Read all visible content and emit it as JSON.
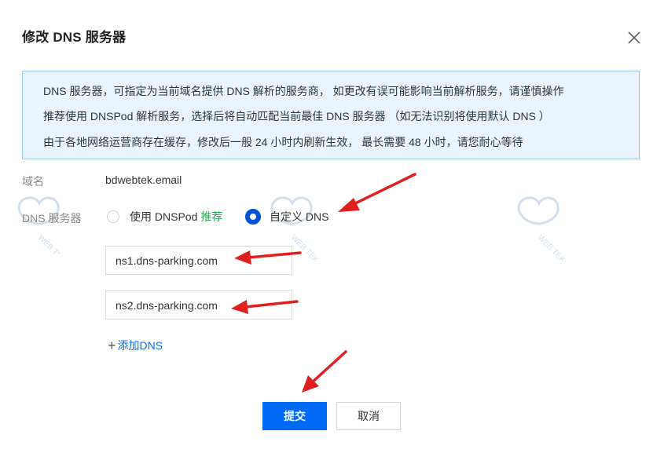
{
  "dialog": {
    "title": "修改 DNS 服务器"
  },
  "notice": {
    "lines": [
      "DNS 服务器，可指定为当前域名提供 DNS 解析的服务商， 如更改有误可能影响当前解析服务，请谨慎操作",
      "推荐使用 DNSPod 解析服务，选择后将自动匹配当前最佳 DNS 服务器 （如无法识别将使用默认 DNS ）",
      "由于各地网络运营商存在缓存，修改后一般 24 小时内刷新生效， 最长需要 48 小时，请您耐心等待"
    ]
  },
  "form": {
    "domain_label": "域名",
    "domain_value": "bdwebtek.email",
    "dns_label": "DNS 服务器",
    "option_dnspod": "使用 DNSPod",
    "option_recommend": "推荐",
    "option_custom": "自定义 DNS",
    "selected_option": "custom",
    "ns1_value": "ns1.dns-parking.com",
    "ns2_value": "ns2.dns-parking.com",
    "add_dns_label": "添加DNS"
  },
  "buttons": {
    "submit": "提交",
    "cancel": "取消"
  },
  "colors": {
    "primary": "#0069f5",
    "radio_selected": "#0052d9",
    "recommend": "#1aad52",
    "notice_bg": "#eaf4ff",
    "annotation_arrow": "#e02020"
  },
  "icons": {
    "close": "close-icon",
    "plus": "plus-icon",
    "watermark": "webtek-logo-watermark"
  }
}
